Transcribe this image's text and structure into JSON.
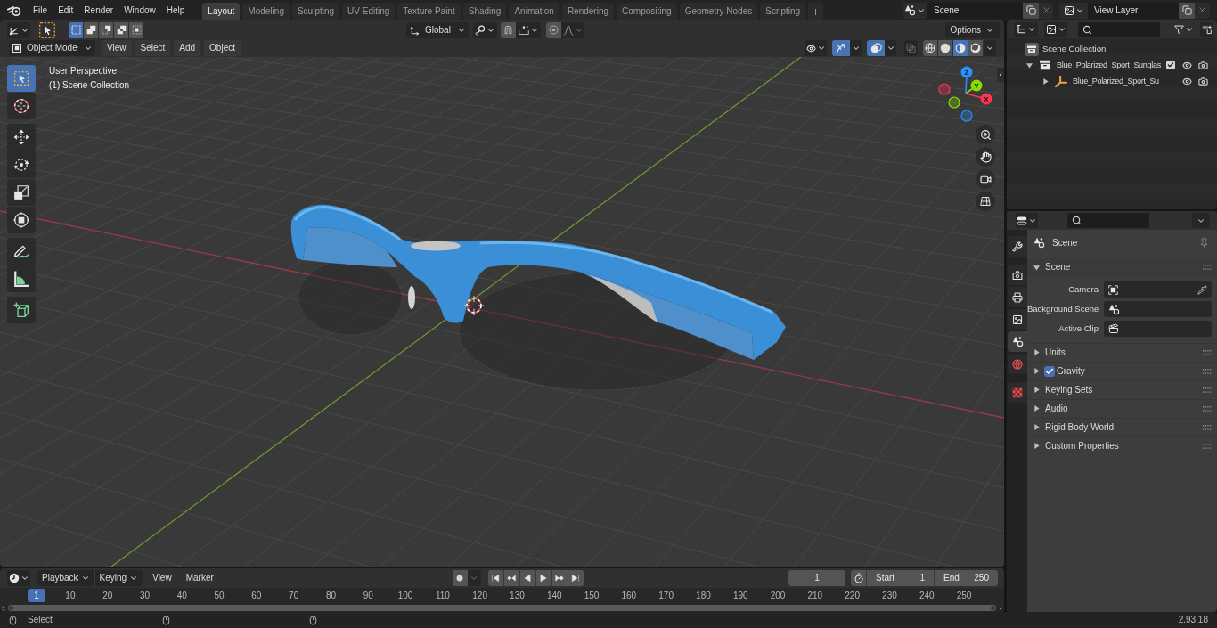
{
  "top_bar": {
    "menus": [
      "File",
      "Edit",
      "Render",
      "Window",
      "Help"
    ],
    "workspaces": [
      {
        "label": "Layout",
        "selected": true
      },
      {
        "label": "Modeling",
        "selected": false
      },
      {
        "label": "Sculpting",
        "selected": false
      },
      {
        "label": "UV Editing",
        "selected": false
      },
      {
        "label": "Texture Paint",
        "selected": false
      },
      {
        "label": "Shading",
        "selected": false
      },
      {
        "label": "Animation",
        "selected": false
      },
      {
        "label": "Rendering",
        "selected": false
      },
      {
        "label": "Compositing",
        "selected": false
      },
      {
        "label": "Geometry Nodes",
        "selected": false
      },
      {
        "label": "Scripting",
        "selected": false
      }
    ],
    "scene": "Scene",
    "view_layer": "View Layer"
  },
  "viewport": {
    "header": {
      "select_modes": [
        {
          "kind": "set",
          "selected": true
        },
        {
          "kind": "extend",
          "selected": false
        },
        {
          "kind": "subtract",
          "selected": false
        },
        {
          "kind": "difference",
          "selected": false
        },
        {
          "kind": "intersect",
          "selected": false
        }
      ],
      "orientation": "Global",
      "options": "Options",
      "mode": "Object Mode",
      "menus": [
        "View",
        "Select",
        "Add",
        "Object"
      ],
      "toggles": [
        {
          "kind": "gizmos",
          "on": true
        },
        {
          "kind": "overlays",
          "on": true
        },
        {
          "kind": "xray",
          "on": false
        }
      ],
      "shading": [
        {
          "kind": "wireframe",
          "selected": false
        },
        {
          "kind": "solid",
          "selected": false
        },
        {
          "kind": "material",
          "selected": true
        },
        {
          "kind": "rendered",
          "selected": false
        }
      ]
    },
    "tool_groups": [
      [
        {
          "kind": "select",
          "selected": true
        },
        {
          "kind": "cursor",
          "selected": false
        }
      ],
      [
        {
          "kind": "move",
          "selected": false
        },
        {
          "kind": "rotate",
          "selected": false
        },
        {
          "kind": "scale",
          "selected": false
        },
        {
          "kind": "transform",
          "selected": false
        }
      ],
      [
        {
          "kind": "annotate",
          "selected": false
        },
        {
          "kind": "measure",
          "selected": false
        }
      ],
      [
        {
          "kind": "add_cube",
          "selected": false
        }
      ]
    ],
    "info": [
      "User Perspective",
      "(1) Scene Collection"
    ],
    "gizmo": [
      {
        "label": "X",
        "color": "#ff3352"
      },
      {
        "label": "Y",
        "color": "#8bdc00"
      },
      {
        "label": "Z",
        "color": "#2890ff"
      }
    ]
  },
  "outliner": {
    "items": [
      {
        "kind": "scene_collection",
        "label": "Scene Collection",
        "children": [
          {
            "kind": "collection",
            "label": "Blue_Polarized_Sport_Sunglas",
            "expanded": true,
            "checked": true,
            "children": [
              {
                "kind": "empty",
                "label": "Blue_Polarized_Sport_Su",
                "expanded": false
              }
            ]
          }
        ]
      }
    ]
  },
  "properties": {
    "tab_groups": [
      [
        {
          "kind": "tool",
          "selected": false
        }
      ],
      [
        {
          "kind": "render",
          "selected": false
        },
        {
          "kind": "output",
          "selected": false
        },
        {
          "kind": "view_layer",
          "selected": false
        },
        {
          "kind": "scene",
          "selected": true
        },
        {
          "kind": "world",
          "selected": false
        }
      ],
      [
        {
          "kind": "texture",
          "selected": false
        }
      ]
    ],
    "context": "Scene",
    "panels": [
      {
        "title": "Scene",
        "expanded": true,
        "fields": [
          {
            "kind": "camera",
            "label": "Camera"
          },
          {
            "kind": "scene",
            "label": "Background Scene"
          },
          {
            "kind": "clip",
            "label": "Active Clip"
          }
        ]
      },
      {
        "title": "Units",
        "expanded": false
      },
      {
        "title": "Gravity",
        "expanded": false,
        "checked": true
      },
      {
        "title": "Keying Sets",
        "expanded": false
      },
      {
        "title": "Audio",
        "expanded": false
      },
      {
        "title": "Rigid Body World",
        "expanded": false
      },
      {
        "title": "Custom Properties",
        "expanded": false
      }
    ]
  },
  "timeline": {
    "menus": [
      {
        "kind": "dropdown",
        "label": "Playback"
      },
      {
        "kind": "dropdown",
        "label": "Keying"
      },
      {
        "kind": "menu",
        "label": "View"
      },
      {
        "kind": "menu",
        "label": "Marker"
      }
    ],
    "current_frame": "1",
    "start_label": "Start",
    "start": "1",
    "end_label": "End",
    "end": "250",
    "playhead": "1",
    "ruler": [
      "10",
      "20",
      "30",
      "40",
      "50",
      "60",
      "70",
      "80",
      "90",
      "100",
      "110",
      "120",
      "130",
      "140",
      "150",
      "160",
      "170",
      "180",
      "190",
      "200",
      "210",
      "220",
      "230",
      "240",
      "250"
    ]
  },
  "status_bar": {
    "hint": "Select",
    "version": "2.93.18"
  }
}
